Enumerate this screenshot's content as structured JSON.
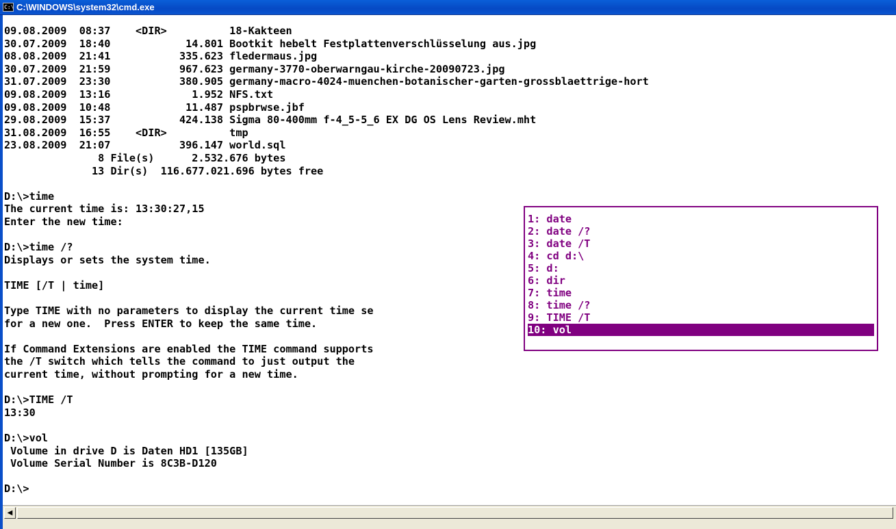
{
  "window": {
    "title": "C:\\WINDOWS\\system32\\cmd.exe",
    "icon_text": "C:\\",
    "icon_name": "cmd-icon"
  },
  "console": {
    "text": "09.08.2009  08:37    <DIR>          18-Kakteen\n30.07.2009  18:40            14.801 Bootkit hebelt Festplattenverschlüsselung aus.jpg\n08.08.2009  21:41           335.623 fledermaus.jpg\n30.07.2009  21:59           967.623 germany-3770-oberwarngau-kirche-20090723.jpg\n31.07.2009  23:30           380.905 germany-macro-4024-muenchen-botanischer-garten-grossblaettrige-hort\n09.08.2009  13:16             1.952 NFS.txt\n09.08.2009  10:48            11.487 pspbrwse.jbf\n29.08.2009  15:37           424.138 Sigma 80-400mm f-4_5-5_6 EX DG OS Lens Review.mht\n31.08.2009  16:55    <DIR>          tmp\n23.08.2009  21:07           396.147 world.sql\n               8 File(s)      2.532.676 bytes\n              13 Dir(s)  116.677.021.696 bytes free\n\nD:\\>time\nThe current time is: 13:30:27,15\nEnter the new time:\n\nD:\\>time /?\nDisplays or sets the system time.\n\nTIME [/T | time]\n\nType TIME with no parameters to display the current time se\nfor a new one.  Press ENTER to keep the same time.\n\nIf Command Extensions are enabled the TIME command supports\nthe /T switch which tells the command to just output the\ncurrent time, without prompting for a new time.\n\nD:\\>TIME /T\n13:30\n\nD:\\>vol\n Volume in drive D is Daten HD1 [135GB]\n Volume Serial Number is 8C3B-D120\n\nD:\\>"
  },
  "history_popup": {
    "items": [
      "1: date",
      "2: date /?",
      "3: date /T",
      "4: cd d:\\",
      "5: d:",
      "6: dir",
      "7: time",
      "8: time /?",
      "9: TIME /T",
      "10: vol"
    ],
    "selected_index": 9,
    "color": "#800080"
  },
  "scrollbar": {
    "left_arrow_glyph": "◀",
    "left_arrow_icon": "scroll-left-arrow-icon"
  }
}
